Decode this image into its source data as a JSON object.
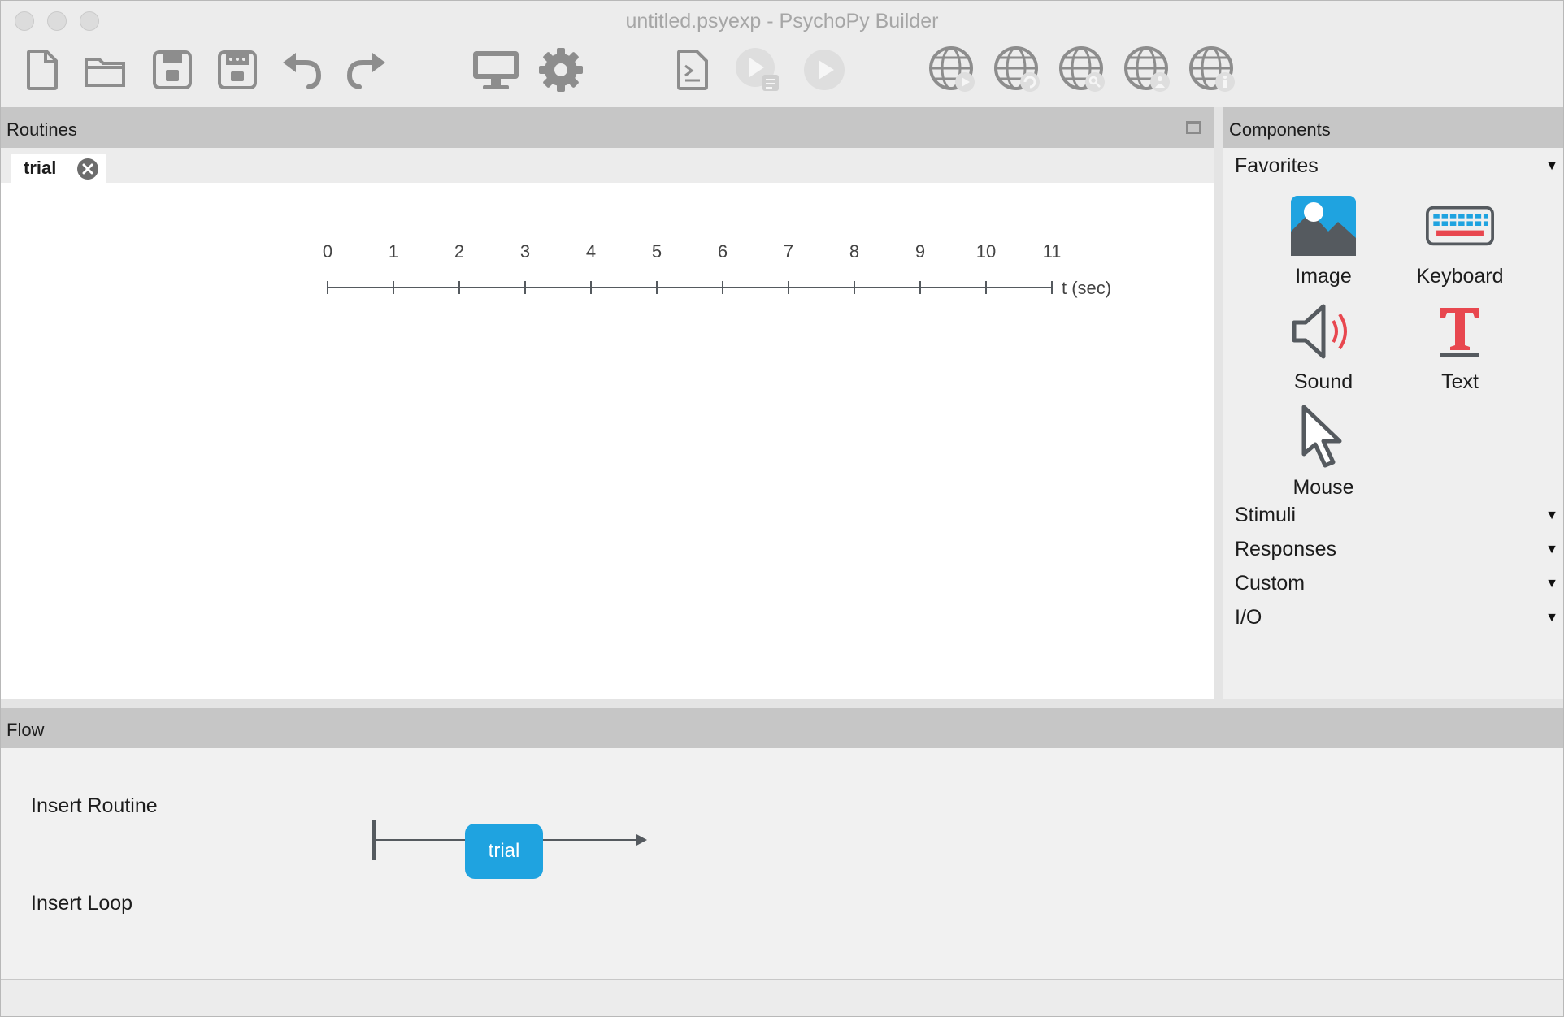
{
  "window": {
    "title": "untitled.psyexp - PsychoPy Builder"
  },
  "toolbar": {
    "buttons": [
      {
        "name": "new-file",
        "icon": "new-file-icon"
      },
      {
        "name": "open",
        "icon": "folder-icon"
      },
      {
        "name": "save",
        "icon": "save-icon"
      },
      {
        "name": "save-as",
        "icon": "save-as-icon"
      },
      {
        "name": "undo",
        "icon": "undo-icon"
      },
      {
        "name": "redo",
        "icon": "redo-icon"
      },
      {
        "name": "monitor-center",
        "icon": "monitor-icon"
      },
      {
        "name": "experiment-settings",
        "icon": "gear-icon"
      },
      {
        "name": "compile-script",
        "icon": "script-icon"
      },
      {
        "name": "run-pilot",
        "icon": "pilot-play-icon"
      },
      {
        "name": "run",
        "icon": "play-icon"
      },
      {
        "name": "online-1",
        "icon": "globe-icon"
      },
      {
        "name": "online-2",
        "icon": "globe-icon"
      },
      {
        "name": "online-3",
        "icon": "globe-icon"
      },
      {
        "name": "online-4",
        "icon": "globe-icon"
      },
      {
        "name": "online-5",
        "icon": "globe-icon"
      }
    ]
  },
  "routines": {
    "header": "Routines",
    "tabs": [
      {
        "label": "trial"
      }
    ],
    "timeline": {
      "ticks": [
        "0",
        "1",
        "2",
        "3",
        "4",
        "5",
        "6",
        "7",
        "8",
        "9",
        "10",
        "11"
      ],
      "unit_label": "t (sec)"
    }
  },
  "components": {
    "header": "Components",
    "categories": {
      "favorites": "Favorites",
      "stimuli": "Stimuli",
      "responses": "Responses",
      "custom": "Custom",
      "io": "I/O"
    },
    "favorites": [
      {
        "label": "Image",
        "icon": "image-icon"
      },
      {
        "label": "Keyboard",
        "icon": "keyboard-icon"
      },
      {
        "label": "Sound",
        "icon": "sound-icon"
      },
      {
        "label": "Text",
        "icon": "text-icon"
      },
      {
        "label": "Mouse",
        "icon": "mouse-cursor-icon"
      }
    ],
    "expand_glyph": "▼"
  },
  "flow": {
    "header": "Flow",
    "insert_routine": "Insert Routine",
    "insert_loop": "Insert Loop",
    "routines": [
      "trial"
    ]
  },
  "colors": {
    "routine_box": "#1fa3e0",
    "panel_header": "#c6c6c6",
    "text_icon_red": "#e8474f",
    "sound_wave_red": "#e8474f",
    "image_icon_blue": "#1fa3e0"
  }
}
